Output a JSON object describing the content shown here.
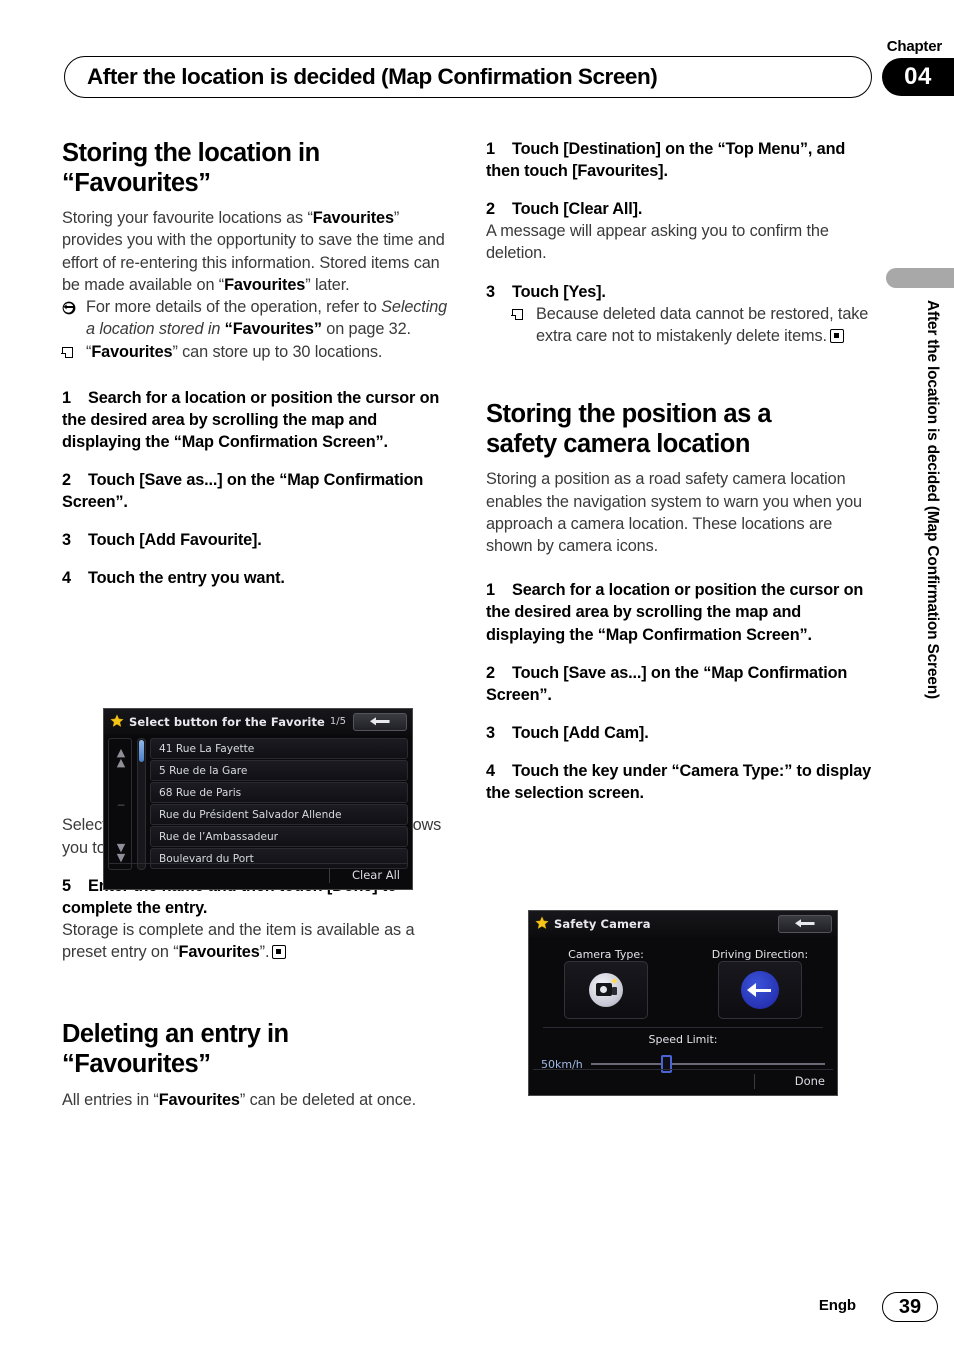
{
  "header": {
    "chapter_word": "Chapter",
    "chapter_number": "04",
    "title": "After the location is decided (Map Confirmation Screen)"
  },
  "side_tab": {
    "text": "After the location is decided (Map Confirmation Screen)"
  },
  "footer": {
    "language": "Engb",
    "page_number": "39"
  },
  "left_column": {
    "section1": {
      "title_line1": "Storing the location in",
      "title_line2": "“Favourites”",
      "intro_a": "Storing your favourite locations as “",
      "intro_b": "Favourites",
      "intro_c": "” provides you with the opportunity to save the time and effort of re-entering this information. Stored items can be made available on “",
      "intro_d": "Favourites",
      "intro_e": "” later.",
      "ref_a": "For more details of the operation, refer to ",
      "ref_b": "Selecting a location stored in ",
      "ref_c": "“Favourites”",
      "ref_d": " on page 32.",
      "note_a": "“",
      "note_b": "Favourites",
      "note_c": "” can store up to 30 locations.",
      "step1": "Search for a location or position the cursor on the desired area by scrolling the map and displaying the “Map Confirmation Screen”.",
      "step1_num": "1",
      "step2": "Touch [Save as...] on the “Map Confirmation Screen”.",
      "step2_num": "2",
      "step3": "Touch [Add Favourite].",
      "step3_num": "3",
      "step4": "Touch the entry you want.",
      "step4_num": "4",
      "after_shot": "Selecting an item that has already been stored allows you to overwrite it.",
      "step5": "Enter the name and then touch [Done] to complete the entry.",
      "step5_num": "5",
      "step5_body_a": "Storage is complete and the item is available as a preset entry on “",
      "step5_body_b": "Favourites",
      "step5_body_c": "”."
    },
    "section2": {
      "title_line1": "Deleting an entry in",
      "title_line2": "“Favourites”",
      "intro_a": "All entries in “",
      "intro_b": "Favourites",
      "intro_c": "” can be deleted at once."
    }
  },
  "right_column": {
    "section2_steps": {
      "step1": "Touch [Destination] on the “Top Menu”, and then touch [Favourites].",
      "step1_num": "1",
      "step2": "Touch [Clear All].",
      "step2_num": "2",
      "step2_body": "A message will appear asking you to confirm the deletion.",
      "step3": "Touch [Yes].",
      "step3_num": "3",
      "step3_note": "Because deleted data cannot be restored, take extra care not to mistakenly delete items."
    },
    "section3": {
      "title_line1": "Storing the position as a",
      "title_line2": "safety camera location",
      "intro": "Storing a position as a road safety camera location enables the navigation system to warn you when you approach a camera location. These locations are shown by camera icons.",
      "step1": "Search for a location or position the cursor on the desired area by scrolling the map and displaying the “Map Confirmation Screen”.",
      "step1_num": "1",
      "step2": "Touch [Save as...] on the “Map Confirmation Screen”.",
      "step2_num": "2",
      "step3": "Touch [Add Cam].",
      "step3_num": "3",
      "step4": "Touch the key under “Camera Type:” to display the selection screen.",
      "step4_num": "4"
    }
  },
  "screenshot_favourites": {
    "title": "Select button for the Favorite",
    "page_indicator": "1/5",
    "star_icon": "star-icon",
    "back_icon": "back-arrow-icon",
    "scroll_up_icon": "chevron-up-icon",
    "scroll_down_icon": "chevron-down-icon",
    "items": [
      "41 Rue La Fayette",
      "5 Rue de la Gare",
      "68 Rue de Paris",
      "Rue du Président Salvador Allende",
      "Rue de l’Ambassadeur",
      "Boulevard du Port"
    ],
    "clear_all_label": "Clear All"
  },
  "screenshot_camera": {
    "title": "Safety Camera",
    "star_icon": "star-icon",
    "back_icon": "back-arrow-icon",
    "camera_type_label": "Camera Type:",
    "driving_direction_label": "Driving Direction:",
    "camera_type_icon": "safety-camera-icon",
    "driving_direction_icon": "left-arrow-sign-icon",
    "speed_limit_label": "Speed Limit:",
    "speed_limit_value": "50km/h",
    "done_label": "Done"
  },
  "colors": {
    "accent_blue": "#2733b4",
    "star_yellow": "#ffd94a",
    "badge_black": "#000000",
    "side_tab_gray": "#a8a8a8"
  }
}
